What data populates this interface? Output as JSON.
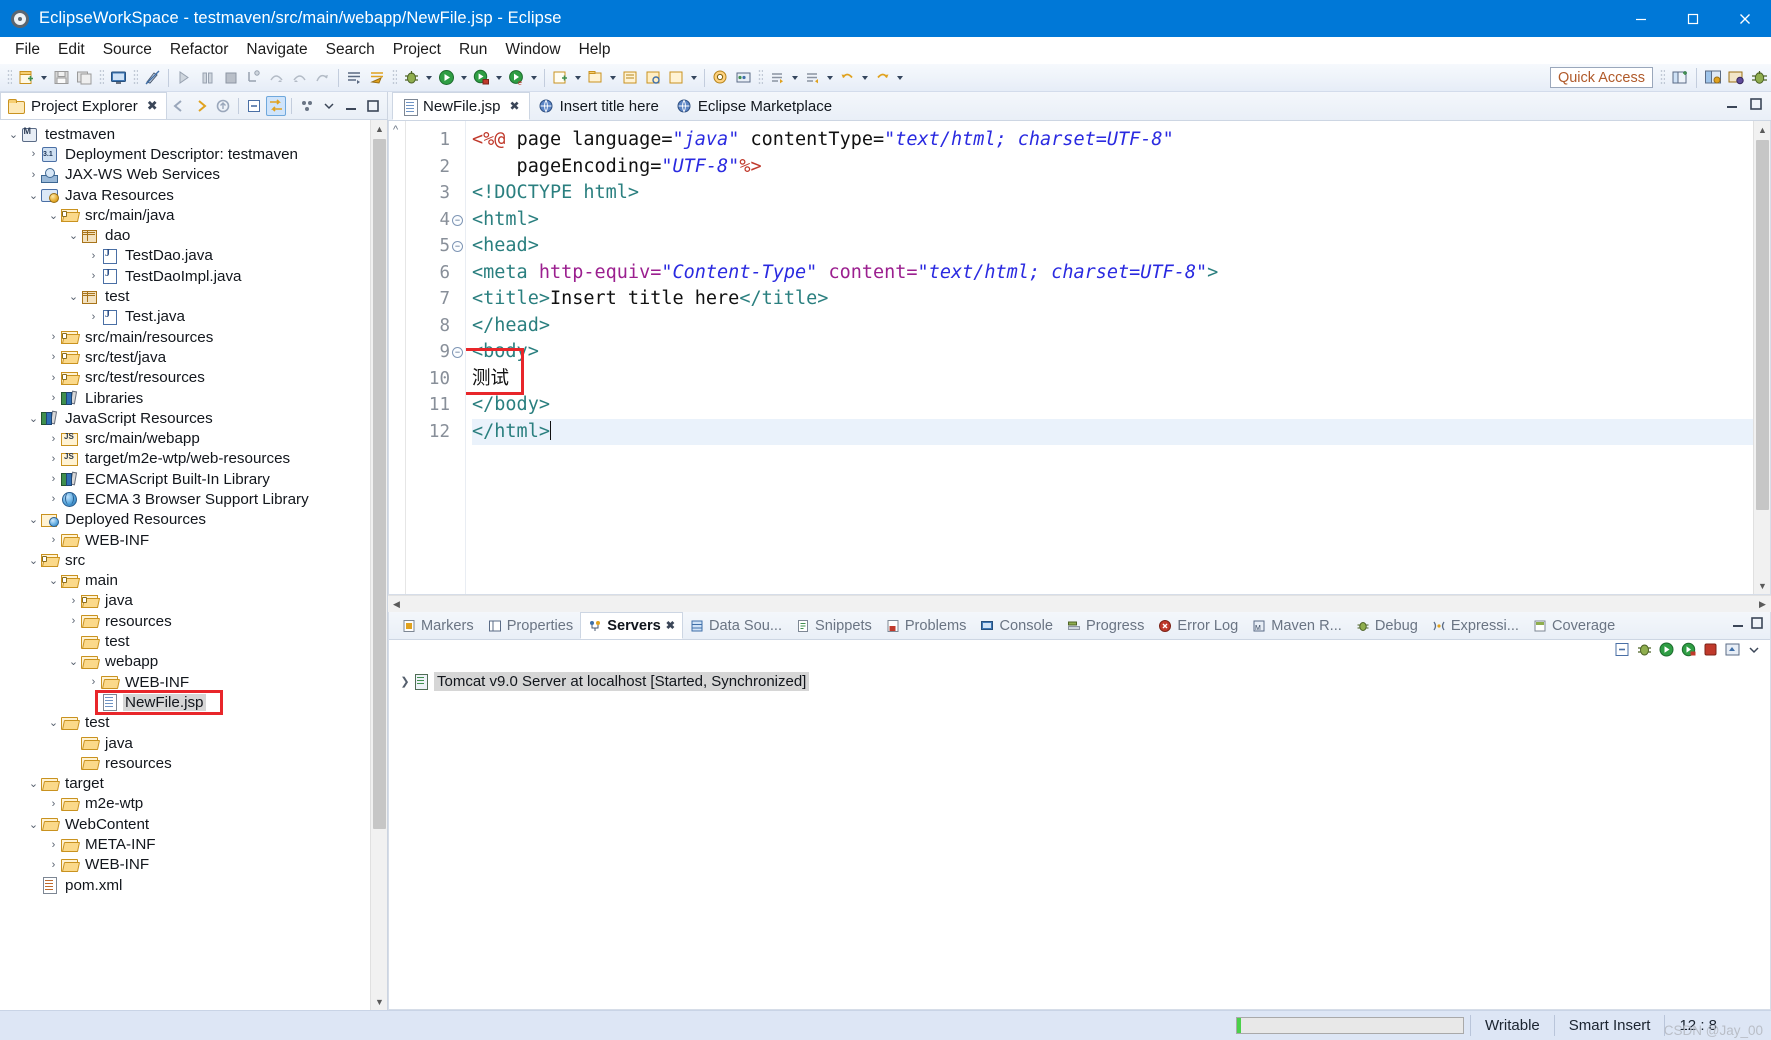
{
  "window": {
    "title": "EclipseWorkSpace - testmaven/src/main/webapp/NewFile.jsp - Eclipse",
    "minimize_label": "Minimize",
    "maximize_label": "Maximize",
    "close_label": "Close"
  },
  "menu": {
    "items": [
      "File",
      "Edit",
      "Source",
      "Refactor",
      "Navigate",
      "Search",
      "Project",
      "Run",
      "Window",
      "Help"
    ]
  },
  "toolbar": {
    "quick_access": "Quick Access"
  },
  "explorer": {
    "tab_label": "Project Explorer",
    "tree": [
      {
        "label": "testmaven",
        "depth": 0,
        "twisty": "down",
        "icon": "maven-project-icon"
      },
      {
        "label": "Deployment Descriptor: testmaven",
        "depth": 1,
        "twisty": "right",
        "icon": "deployment-descriptor-icon"
      },
      {
        "label": "JAX-WS Web Services",
        "depth": 1,
        "twisty": "right",
        "icon": "jaxws-icon"
      },
      {
        "label": "Java Resources",
        "depth": 1,
        "twisty": "down",
        "icon": "java-resources-icon"
      },
      {
        "label": "src/main/java",
        "depth": 2,
        "twisty": "down",
        "icon": "source-folder-icon"
      },
      {
        "label": "dao",
        "depth": 3,
        "twisty": "down",
        "icon": "package-icon"
      },
      {
        "label": "TestDao.java",
        "depth": 4,
        "twisty": "right",
        "icon": "java-interface-icon"
      },
      {
        "label": "TestDaoImpl.java",
        "depth": 4,
        "twisty": "right",
        "icon": "java-class-icon"
      },
      {
        "label": "test",
        "depth": 3,
        "twisty": "down",
        "icon": "package-icon"
      },
      {
        "label": "Test.java",
        "depth": 4,
        "twisty": "right",
        "icon": "java-class-icon"
      },
      {
        "label": "src/main/resources",
        "depth": 2,
        "twisty": "right",
        "icon": "source-folder-icon"
      },
      {
        "label": "src/test/java",
        "depth": 2,
        "twisty": "right",
        "icon": "source-folder-icon"
      },
      {
        "label": "src/test/resources",
        "depth": 2,
        "twisty": "right",
        "icon": "source-folder-icon"
      },
      {
        "label": "Libraries",
        "depth": 2,
        "twisty": "right",
        "icon": "libraries-icon"
      },
      {
        "label": "JavaScript Resources",
        "depth": 1,
        "twisty": "down",
        "icon": "libraries-icon"
      },
      {
        "label": "src/main/webapp",
        "depth": 2,
        "twisty": "right",
        "icon": "javascript-folder-icon"
      },
      {
        "label": "target/m2e-wtp/web-resources",
        "depth": 2,
        "twisty": "right",
        "icon": "javascript-folder-icon"
      },
      {
        "label": "ECMAScript Built-In Library",
        "depth": 2,
        "twisty": "right",
        "icon": "libraries-icon"
      },
      {
        "label": "ECMA 3 Browser Support Library",
        "depth": 2,
        "twisty": "right",
        "icon": "globe-icon"
      },
      {
        "label": "Deployed Resources",
        "depth": 1,
        "twisty": "down",
        "icon": "deployed-resources-icon"
      },
      {
        "label": "WEB-INF",
        "depth": 2,
        "twisty": "right",
        "icon": "folder-open-icon"
      },
      {
        "label": "src",
        "depth": 1,
        "twisty": "down",
        "icon": "source-folder-icon"
      },
      {
        "label": "main",
        "depth": 2,
        "twisty": "down",
        "icon": "source-folder-icon"
      },
      {
        "label": "java",
        "depth": 3,
        "twisty": "right",
        "icon": "source-folder-icon"
      },
      {
        "label": "resources",
        "depth": 3,
        "twisty": "right",
        "icon": "folder-open-icon"
      },
      {
        "label": "test",
        "depth": 3,
        "twisty": "none",
        "icon": "folder-open-icon"
      },
      {
        "label": "webapp",
        "depth": 3,
        "twisty": "down",
        "icon": "folder-open-icon"
      },
      {
        "label": "WEB-INF",
        "depth": 4,
        "twisty": "right",
        "icon": "folder-open-icon"
      },
      {
        "label": "NewFile.jsp",
        "depth": 4,
        "twisty": "none",
        "icon": "jsp-file-icon",
        "selected": true,
        "annotated": true
      },
      {
        "label": "test",
        "depth": 2,
        "twisty": "down",
        "icon": "folder-open-icon"
      },
      {
        "label": "java",
        "depth": 3,
        "twisty": "none",
        "icon": "folder-open-icon"
      },
      {
        "label": "resources",
        "depth": 3,
        "twisty": "none",
        "icon": "folder-open-icon"
      },
      {
        "label": "target",
        "depth": 1,
        "twisty": "down",
        "icon": "folder-open-icon"
      },
      {
        "label": "m2e-wtp",
        "depth": 2,
        "twisty": "right",
        "icon": "folder-open-icon"
      },
      {
        "label": "WebContent",
        "depth": 1,
        "twisty": "down",
        "icon": "folder-open-icon"
      },
      {
        "label": "META-INF",
        "depth": 2,
        "twisty": "right",
        "icon": "folder-open-icon"
      },
      {
        "label": "WEB-INF",
        "depth": 2,
        "twisty": "right",
        "icon": "folder-open-icon"
      },
      {
        "label": "pom.xml",
        "depth": 1,
        "twisty": "none",
        "icon": "xml-file-icon"
      }
    ]
  },
  "editor": {
    "tabs": [
      {
        "label": "NewFile.jsp",
        "active": true,
        "icon": "jsp-file-icon",
        "closable": true
      },
      {
        "label": "Insert title here",
        "active": false,
        "icon": "browser-icon",
        "closable": false
      },
      {
        "label": "Eclipse Marketplace",
        "active": false,
        "icon": "browser-icon",
        "closable": false
      }
    ],
    "lines": [
      {
        "num": "1",
        "fold": false,
        "current": false,
        "tokens": [
          {
            "t": "jsp",
            "v": "<%@ "
          },
          {
            "t": "txt",
            "v": "page language="
          },
          {
            "t": "str",
            "v": "\"java\""
          },
          {
            "t": "txt",
            "v": " contentType="
          },
          {
            "t": "str",
            "v": "\"text/html; charset=UTF-8\""
          }
        ]
      },
      {
        "num": "2",
        "fold": false,
        "current": false,
        "tokens": [
          {
            "t": "txt",
            "v": "    pageEncoding="
          },
          {
            "t": "str",
            "v": "\"UTF-8\""
          },
          {
            "t": "jsp",
            "v": "%>"
          }
        ]
      },
      {
        "num": "3",
        "fold": false,
        "current": false,
        "tokens": [
          {
            "t": "tag",
            "v": "<!DOCTYPE html>"
          }
        ]
      },
      {
        "num": "4",
        "fold": true,
        "current": false,
        "tokens": [
          {
            "t": "tag",
            "v": "<html>"
          }
        ]
      },
      {
        "num": "5",
        "fold": true,
        "current": false,
        "tokens": [
          {
            "t": "tag",
            "v": "<head>"
          }
        ]
      },
      {
        "num": "6",
        "fold": false,
        "current": false,
        "tokens": [
          {
            "t": "tag",
            "v": "<meta "
          },
          {
            "t": "attr",
            "v": "http-equiv="
          },
          {
            "t": "str",
            "v": "\"Content-Type\""
          },
          {
            "t": "txt",
            "v": " "
          },
          {
            "t": "attr",
            "v": "content="
          },
          {
            "t": "str",
            "v": "\"text/html; charset=UTF-8\""
          },
          {
            "t": "tag",
            "v": ">"
          }
        ]
      },
      {
        "num": "7",
        "fold": false,
        "current": false,
        "tokens": [
          {
            "t": "tag",
            "v": "<title>"
          },
          {
            "t": "txt",
            "v": "Insert title here"
          },
          {
            "t": "tag",
            "v": "</title>"
          }
        ]
      },
      {
        "num": "8",
        "fold": false,
        "current": false,
        "tokens": [
          {
            "t": "tag",
            "v": "</head>"
          }
        ]
      },
      {
        "num": "9",
        "fold": true,
        "current": false,
        "tokens": [
          {
            "t": "tag",
            "v": "<body>"
          }
        ]
      },
      {
        "num": "10",
        "fold": false,
        "current": false,
        "tokens": [
          {
            "t": "txt",
            "v": "测试"
          }
        ]
      },
      {
        "num": "11",
        "fold": false,
        "current": false,
        "tokens": [
          {
            "t": "tag",
            "v": "</body>"
          }
        ]
      },
      {
        "num": "12",
        "fold": false,
        "current": true,
        "tokens": [
          {
            "t": "tag",
            "v": "</html>"
          }
        ]
      }
    ]
  },
  "bottom_panel": {
    "tabs": [
      {
        "label": "Markers",
        "active": false,
        "icon": "markers-icon"
      },
      {
        "label": "Properties",
        "active": false,
        "icon": "properties-icon"
      },
      {
        "label": "Servers",
        "active": true,
        "icon": "servers-icon",
        "closable": true
      },
      {
        "label": "Data Sou...",
        "active": false,
        "icon": "data-source-icon"
      },
      {
        "label": "Snippets",
        "active": false,
        "icon": "snippets-icon"
      },
      {
        "label": "Problems",
        "active": false,
        "icon": "problems-icon"
      },
      {
        "label": "Console",
        "active": false,
        "icon": "console-icon"
      },
      {
        "label": "Progress",
        "active": false,
        "icon": "progress-icon"
      },
      {
        "label": "Error Log",
        "active": false,
        "icon": "error-log-icon"
      },
      {
        "label": "Maven R...",
        "active": false,
        "icon": "maven-repositories-icon"
      },
      {
        "label": "Debug",
        "active": false,
        "icon": "debug-icon"
      },
      {
        "label": "Expressi...",
        "active": false,
        "icon": "expressions-icon"
      },
      {
        "label": "Coverage",
        "active": false,
        "icon": "coverage-icon"
      }
    ],
    "server_row": {
      "label": "Tomcat v9.0 Server at localhost  [Started, Synchronized]"
    }
  },
  "statusbar": {
    "writable": "Writable",
    "insert_mode": "Smart Insert",
    "position": "12 : 8"
  },
  "watermark": "CSDN @Jay_00"
}
